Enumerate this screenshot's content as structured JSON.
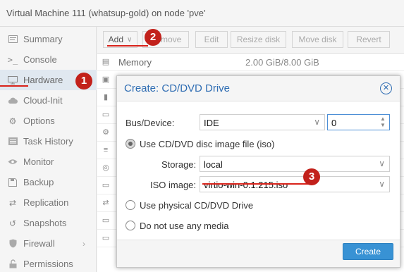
{
  "window": {
    "title": "Virtual Machine 111 (whatsup-gold) on node 'pve'"
  },
  "nav": {
    "items": [
      {
        "label": "Summary",
        "icon": "summary-icon"
      },
      {
        "label": "Console",
        "icon": "terminal-icon"
      },
      {
        "label": "Hardware",
        "icon": "monitor-icon",
        "active": true
      },
      {
        "label": "Cloud-Init",
        "icon": "cloud-icon"
      },
      {
        "label": "Options",
        "icon": "gear-icon"
      },
      {
        "label": "Task History",
        "icon": "list-icon"
      },
      {
        "label": "Monitor",
        "icon": "eye-icon"
      },
      {
        "label": "Backup",
        "icon": "floppy-icon"
      },
      {
        "label": "Replication",
        "icon": "retweet-icon"
      },
      {
        "label": "Snapshots",
        "icon": "history-icon"
      },
      {
        "label": "Firewall",
        "icon": "shield-icon"
      },
      {
        "label": "Permissions",
        "icon": "unlock-icon"
      }
    ]
  },
  "toolbar": {
    "add": "Add",
    "remove": "Remove",
    "edit": "Edit",
    "resize": "Resize disk",
    "move": "Move disk",
    "revert": "Revert"
  },
  "hardware": {
    "memory_label": "Memory",
    "memory_value": "2.00 GiB/8.00 GiB"
  },
  "dialog": {
    "title": "Create: CD/DVD Drive",
    "bus_label": "Bus/Device:",
    "bus_value": "IDE",
    "device_value": "0",
    "opt_iso": "Use CD/DVD disc image file (iso)",
    "storage_label": "Storage:",
    "storage_value": "local",
    "iso_label": "ISO image:",
    "iso_value": "virtio-win-0.1.215.iso",
    "opt_physical": "Use physical CD/DVD Drive",
    "opt_none": "Do not use any media",
    "create": "Create"
  },
  "annotations": {
    "a1": "1",
    "a2": "2",
    "a3": "3"
  },
  "colors": {
    "accent": "#3892d4",
    "title_blue": "#2f6db3",
    "annotation_red": "#c2211b"
  }
}
